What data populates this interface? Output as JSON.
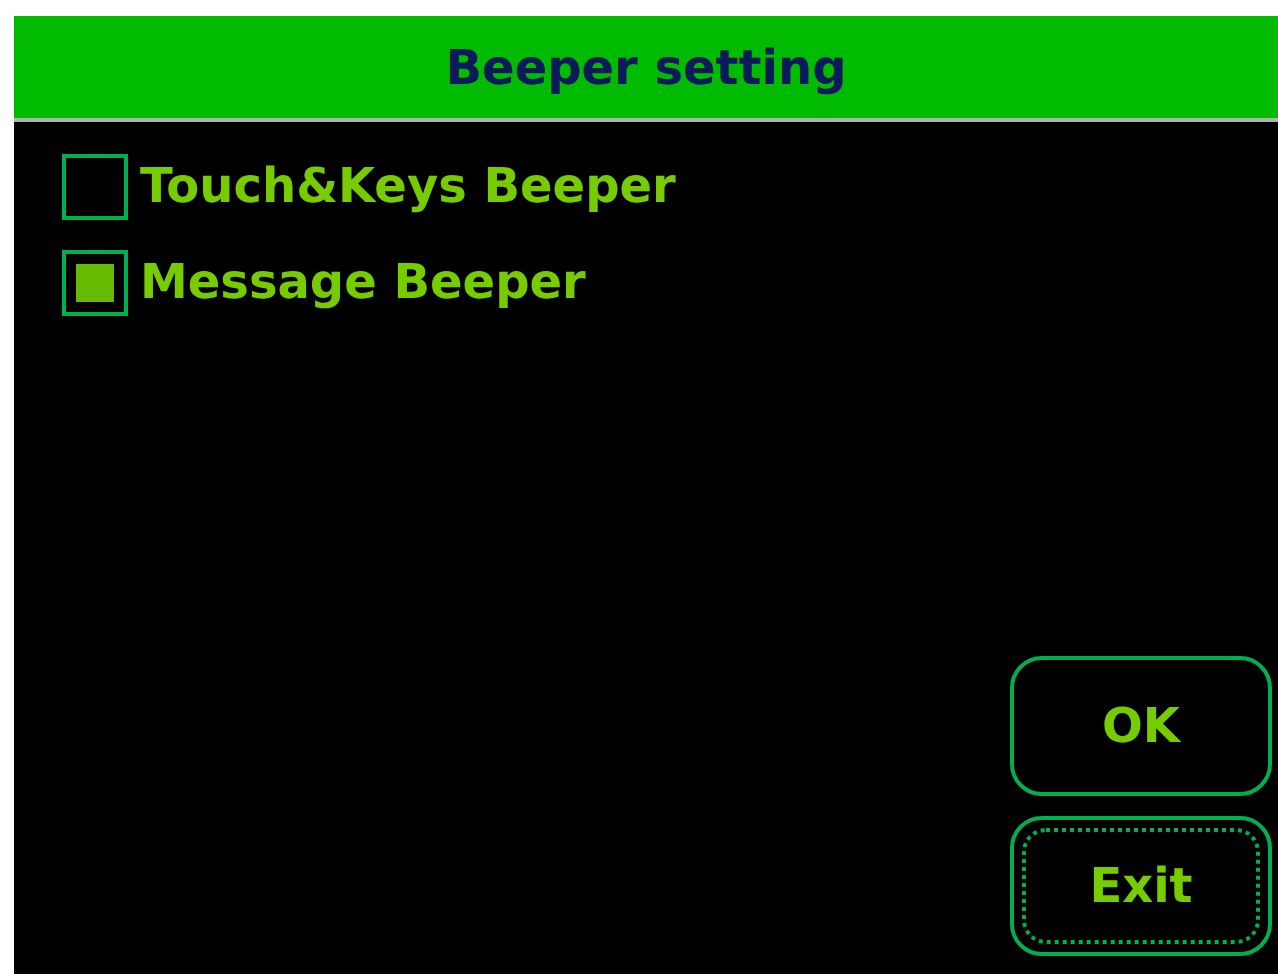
{
  "window": {
    "title": "Beeper setting"
  },
  "options": [
    {
      "label": "Touch&Keys Beeper",
      "checked": false
    },
    {
      "label": "Message Beeper",
      "checked": true
    }
  ],
  "buttons": [
    {
      "label": "OK",
      "focused": false
    },
    {
      "label": "Exit",
      "focused": true
    }
  ]
}
